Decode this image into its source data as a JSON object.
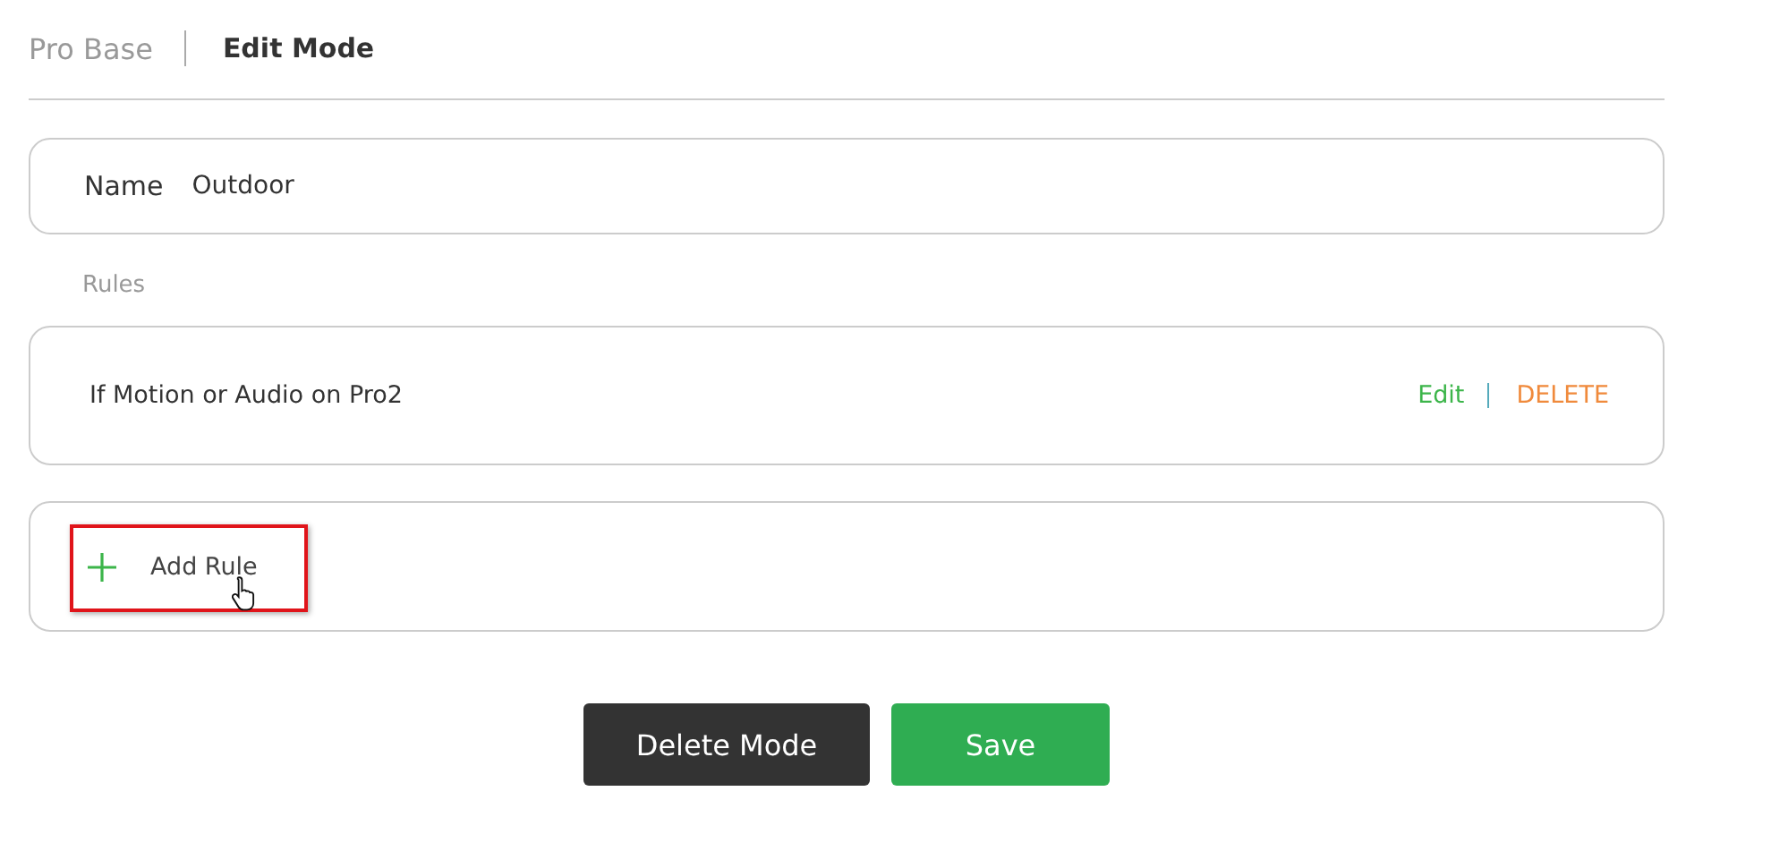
{
  "breadcrumb": [
    {
      "label": "Pro Base",
      "selected": false
    },
    {
      "label": "Edit Mode",
      "selected": true
    }
  ],
  "name_field": {
    "label": "Name",
    "value": "Outdoor"
  },
  "rules_title": "Rules",
  "rules": [
    {
      "text": "If Motion or Audio on Pro2",
      "edit": "Edit",
      "delete": "DELETE"
    }
  ],
  "add_rule": {
    "label": "Add Rule",
    "highlighted": true
  },
  "buttons": [
    {
      "label": "Delete Mode",
      "kind": "dark"
    },
    {
      "label": "Save",
      "kind": "primary"
    }
  ]
}
